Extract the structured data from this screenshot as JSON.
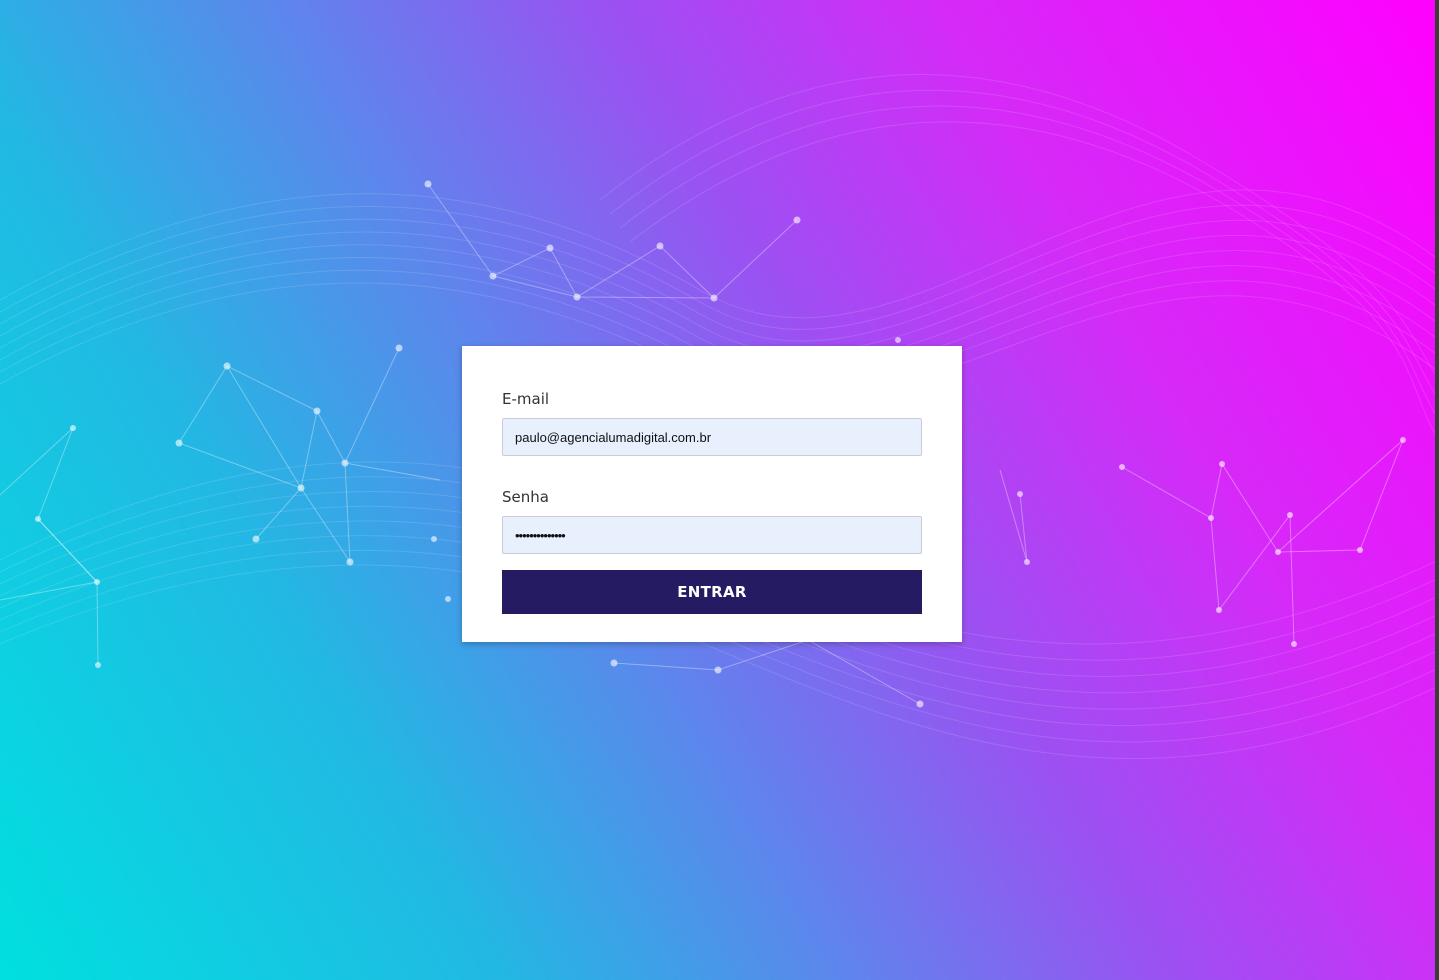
{
  "form": {
    "email_label": "E-mail",
    "email_value": "paulo@agencialumadigital.com.br",
    "password_label": "Senha",
    "password_value": "••••••••••••••",
    "submit_label": "ENTRAR"
  },
  "colors": {
    "background_start": "#00e0e0",
    "background_end": "#ff00ff",
    "button": "#251b63",
    "input_fill": "#e8f0fe"
  }
}
